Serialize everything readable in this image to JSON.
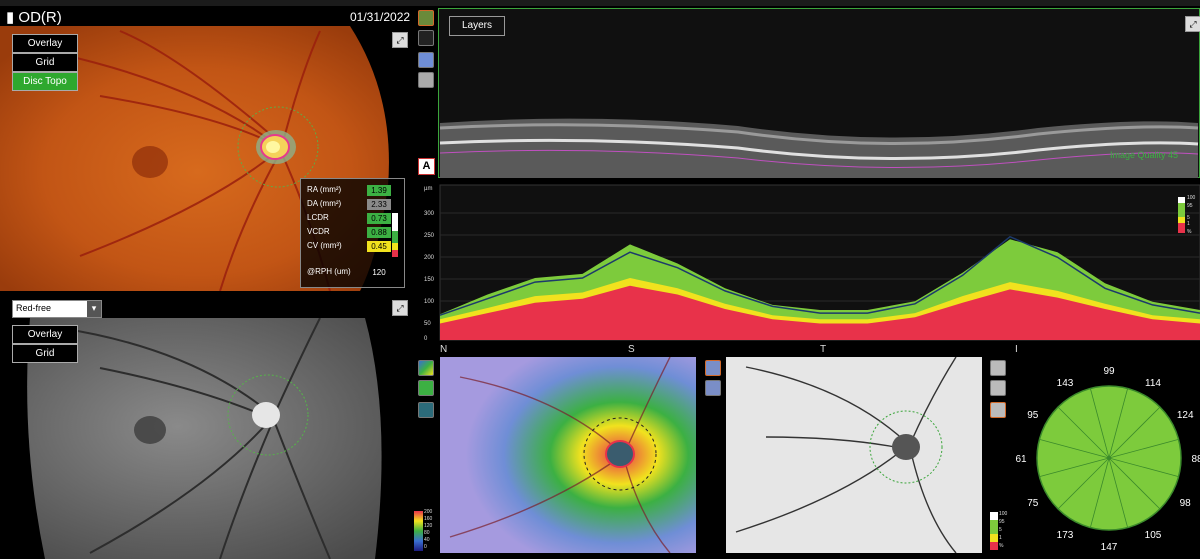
{
  "header": {
    "eye": "OD(R)",
    "date": "01/31/2022"
  },
  "fundus_overlay_buttons": [
    "Overlay",
    "Grid",
    "Disc Topo"
  ],
  "redfree_overlay_buttons": [
    "Overlay",
    "Grid"
  ],
  "image_mode_select": {
    "value": "Red-free"
  },
  "disc_stats": {
    "rows": [
      {
        "label": "RA (mm²)",
        "value": "1.39",
        "color": "#3cb043"
      },
      {
        "label": "DA (mm²)",
        "value": "2.33",
        "color": "#8a8a8a"
      },
      {
        "label": "LCDR",
        "value": "0.73",
        "color": "#3cb043"
      },
      {
        "label": "VCDR",
        "value": "0.88",
        "color": "#3cb043"
      },
      {
        "label": "CV (mm³)",
        "value": "0.45",
        "color": "#f1e21e"
      }
    ],
    "rph_label": "@RPH (um)",
    "rph_value": "120"
  },
  "bscan": {
    "layers_label": "Layers",
    "quality_text": "Image Quality 45",
    "annotate_label": "A"
  },
  "rnfl_chart_axis": {
    "unit": "µm",
    "yticks": [
      "300",
      "250",
      "200",
      "150",
      "100",
      "50",
      "0"
    ],
    "legend_ticks": [
      "100",
      "95",
      "5",
      "1",
      "%"
    ]
  },
  "tsnit_labels": [
    "N",
    "S",
    "T",
    "I"
  ],
  "chart_data": {
    "type": "area",
    "title": "",
    "xlabel": "",
    "ylabel": "µm",
    "ylim": [
      0,
      300
    ],
    "x": [
      0,
      32,
      64,
      96,
      128,
      160,
      192,
      224,
      256
    ],
    "xticklabels": [
      "N",
      "S",
      "T",
      "I",
      ""
    ],
    "series": [
      {
        "values": [
          50,
          88,
          120,
          128,
          185,
          148,
          100,
          68,
          58,
          58,
          75,
          130,
          195,
          170,
          110,
          74,
          58
        ]
      },
      {
        "values": [
          40,
          62,
          85,
          92,
          120,
          100,
          70,
          48,
          40,
          40,
          52,
          85,
          112,
          95,
          70,
          48,
          40
        ]
      },
      {
        "values": [
          32,
          52,
          72,
          80,
          105,
          88,
          60,
          40,
          32,
          32,
          44,
          72,
          98,
          82,
          60,
          40,
          32
        ]
      },
      {
        "values": [
          48,
          80,
          112,
          120,
          170,
          140,
          95,
          65,
          52,
          52,
          70,
          125,
          200,
          160,
          100,
          68,
          52
        ]
      }
    ]
  },
  "thickness_map_legend": [
    "200",
    "160",
    "120",
    "80",
    "40",
    "0"
  ],
  "deviation_legend": [
    "100",
    "95",
    "5",
    "1",
    "%"
  ],
  "sector_values": [
    "99",
    "114",
    "124",
    "88",
    "98",
    "105",
    "147",
    "173",
    "75",
    "61",
    "95",
    "143"
  ],
  "colors": {
    "green_normal": "#7dcb3c",
    "yellow_borderline": "#f1e21e",
    "red_outside": "#e8324a",
    "panel_border": "#3ba53b"
  }
}
